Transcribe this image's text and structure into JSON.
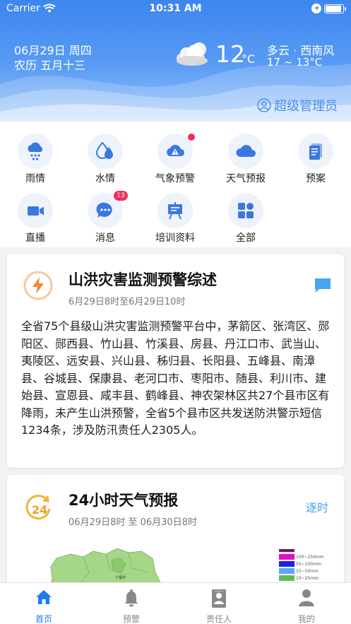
{
  "status_bar": {
    "carrier": "Carrier",
    "time": "10:31 AM"
  },
  "header": {
    "date": "06月29日 周四",
    "lunar": "农历 五月十三",
    "temperature": "12",
    "temp_unit": "°C",
    "condition": "多云 · 西南风",
    "range": "17 ~ 13°C",
    "user_role": "超级管理员"
  },
  "grid": [
    {
      "label": "雨情",
      "icon": "rain-icon"
    },
    {
      "label": "水情",
      "icon": "water-drop-icon"
    },
    {
      "label": "气象预警",
      "icon": "weather-warning-icon",
      "dot": true
    },
    {
      "label": "天气预报",
      "icon": "cloud-icon"
    },
    {
      "label": "预案",
      "icon": "document-icon"
    },
    {
      "label": "直播",
      "icon": "video-camera-icon"
    },
    {
      "label": "消息",
      "icon": "chat-bubble-icon",
      "badge": "13"
    },
    {
      "label": "培训资料",
      "icon": "easel-board-icon"
    },
    {
      "label": "全部",
      "icon": "apps-grid-icon"
    }
  ],
  "summary_card": {
    "title": "山洪灾害监测预警综述",
    "subtitle": "6月29日8时至6月29日10时",
    "body": "全省75个县级山洪灾害监测预警平台中，茅箭区、张湾区、郧阳区、郧西县、竹山县、竹溪县、房县、丹江口市、武当山、夷陵区、远安县、兴山县、秭归县、长阳县、五峰县、南漳县、谷城县、保康县、老河口市、枣阳市、随县、利川市、建始县、宣恩县、咸丰县、鹤峰县、神农架林区共27个县市区有降雨，未产生山洪预警，全省5个县市区共发送防洪警示短信1234条，涉及防汛责任人2305人。"
  },
  "forecast_card": {
    "title": "24小时天气预报",
    "subtitle": "06月29日8时 至 06月30日8时",
    "link": "逐时",
    "icon_number": "24",
    "map_label": "十堰市",
    "legend": [
      {
        "label": "100~250mm",
        "color": "#e010c8"
      },
      {
        "label": "50~100mm",
        "color": "#2020e0"
      },
      {
        "label": "25~50mm",
        "color": "#5aa8f0"
      },
      {
        "label": "10~25mm",
        "color": "#60b860"
      }
    ]
  },
  "tabbar": [
    {
      "label": "首页",
      "active": true
    },
    {
      "label": "预警",
      "active": false
    },
    {
      "label": "责任人",
      "active": false
    },
    {
      "label": "我的",
      "active": false
    }
  ]
}
